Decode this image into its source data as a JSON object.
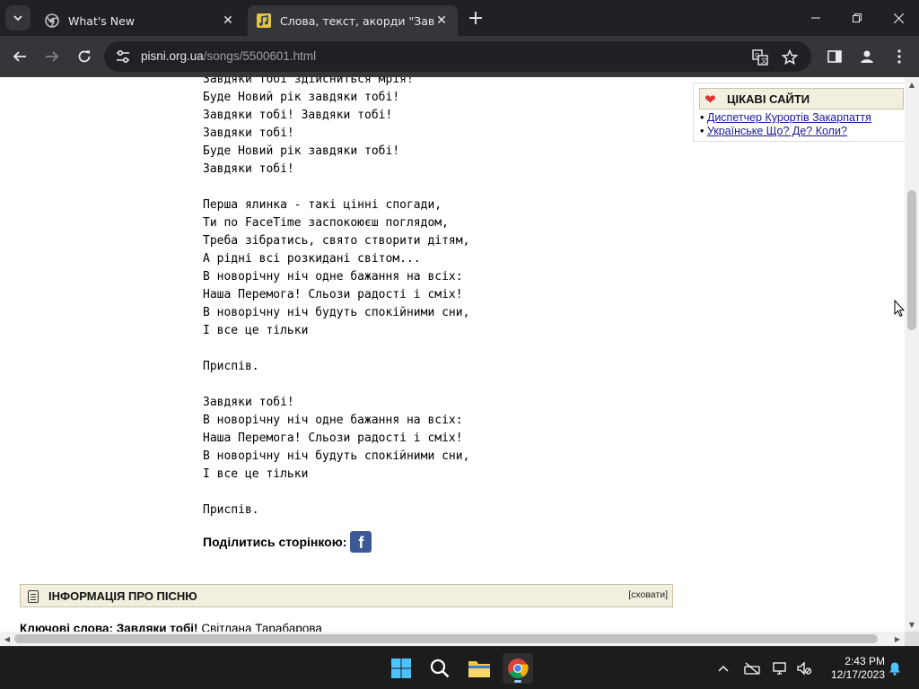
{
  "browser": {
    "tabs": [
      {
        "title": "What's New",
        "active": false
      },
      {
        "title": "Слова, текст, акорди \"Завдяки",
        "active": true
      }
    ],
    "url_host": "pisni.org.ua",
    "url_path": "/songs/5500601.html"
  },
  "lyrics": [
    "Завдяки тобі здійсниться мрія!",
    "Буде Новий рік завдяки тобі!",
    "Завдяки тобі! Завдяки тобі!",
    "Завдяки тобі!",
    "Буде Новий рік завдяки тобі!",
    "Завдяки тобі!",
    "",
    "Перша ялинка - такі цінні спогади,",
    "Ти по FaceTime заспокоюєш поглядом,",
    "Треба зібратись, свято створити дітям,",
    "А рідні всі розкидані світом...",
    "В новорічну ніч одне бажання на всіх:",
    "Наша Перемога! Сльози радості і сміх!",
    "В новорічну ніч будуть спокійними сни,",
    "І все це тільки",
    "",
    "Приспів.",
    "",
    "Завдяки тобі!",
    "В новорічну ніч одне бажання на всіх:",
    "Наша Перемога! Сльози радості і сміх!",
    "В новорічну ніч будуть спокійними сни,",
    "І все це тільки",
    "",
    "Приспів."
  ],
  "share": {
    "label": "Поділитись сторінкою:"
  },
  "info": {
    "title": "ІНФОРМАЦІЯ ПРО ПІСНЮ",
    "hide_label": "[сховати]"
  },
  "keywords": {
    "label": "Ключові слова:",
    "bold_value": "Завдяки тобі!",
    "value": "Світлана Тарабарова"
  },
  "sites": {
    "title": "ЦІКАВІ САЙТИ",
    "links": [
      "Диспетчер Курортів Закарпаття",
      "Українське Що? Де? Коли?"
    ]
  },
  "clock": {
    "time": "2:43 PM",
    "date": "12/17/2023"
  }
}
